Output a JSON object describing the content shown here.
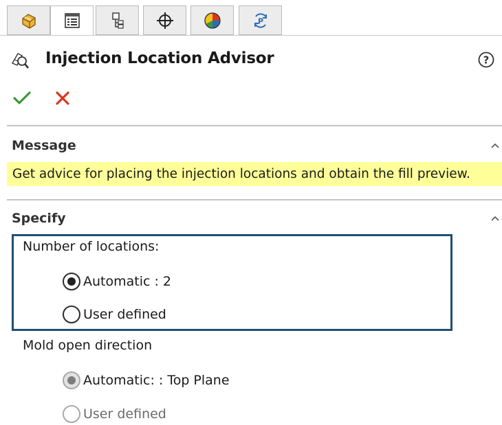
{
  "tabs": [
    {
      "icon": "feature-manager-icon"
    },
    {
      "icon": "property-manager-icon",
      "active": true
    },
    {
      "icon": "configuration-manager-icon"
    },
    {
      "icon": "dimxpert-manager-icon"
    },
    {
      "icon": "display-manager-icon"
    },
    {
      "icon": "plastics-manager-icon"
    }
  ],
  "header": {
    "title": "Injection Location Advisor",
    "icon": "injection-advisor-icon",
    "help_icon": "help-icon"
  },
  "actions": {
    "ok_icon": "checkmark-icon",
    "cancel_icon": "close-icon"
  },
  "message_section": {
    "title": "Message",
    "text": "Get advice for placing the injection locations and obtain the fill preview."
  },
  "specify_section": {
    "title": "Specify",
    "number_of_locations": {
      "label": "Number of locations:",
      "options": [
        "Automatic : 2",
        "User defined"
      ],
      "selected": "Automatic : 2"
    },
    "mold_open_direction": {
      "label": "Mold open direction",
      "options": [
        "Automatic: : Top Plane",
        "User defined"
      ],
      "selected": "Automatic: : Top Plane",
      "disabled": true
    }
  },
  "colors": {
    "message_background": "#ffff99",
    "highlight_border": "#1e4f71",
    "ok_green": "#3a9a3a",
    "cancel_red": "#d9361e"
  }
}
